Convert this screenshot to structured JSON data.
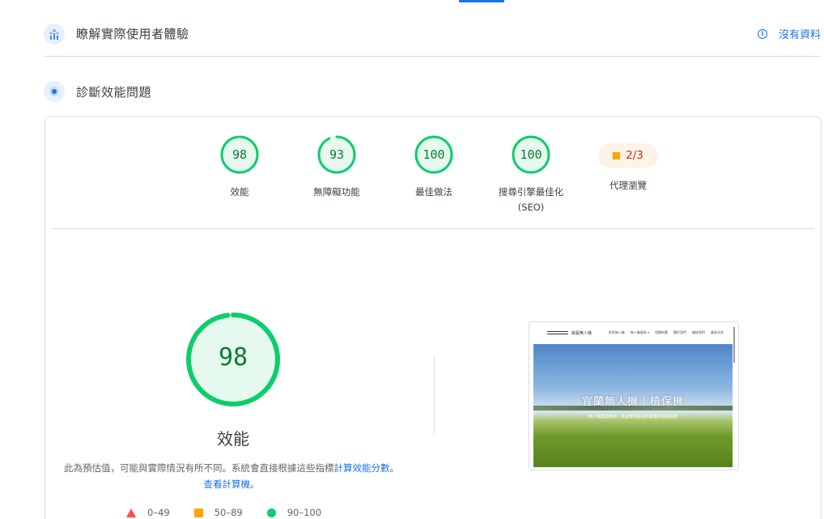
{
  "sections": {
    "experience_title": "瞭解實際使用者體驗",
    "no_data_label": "沒有資料",
    "diagnose_title": "診斷效能問題"
  },
  "gauges": [
    {
      "score": "98",
      "label": "效能",
      "value": 98
    },
    {
      "score": "93",
      "label": "無障礙功能",
      "value": 93
    },
    {
      "score": "100",
      "label": "最佳做法",
      "value": 100
    },
    {
      "score": "100",
      "label": "搜尋引擎最佳化",
      "label2": "(SEO)",
      "value": 100
    }
  ],
  "pwa": {
    "score": "2/3",
    "label": "代理瀏覽"
  },
  "main": {
    "score": "98",
    "value": 98,
    "title": "效能",
    "disclaimer_text": "此為預估值，可能與實際情況有所不同。系統會直接根據這些指標",
    "disclaimer_link1": "計算效能分數",
    "disclaimer_sep": "。",
    "disclaimer_link2": "查看計算機",
    "disclaimer_end": "。"
  },
  "legend": [
    {
      "range": "0–49",
      "shape": "triangle",
      "color": "#ff4e42"
    },
    {
      "range": "50–89",
      "shape": "square",
      "color": "#ffa400"
    },
    {
      "range": "90–100",
      "shape": "circle",
      "color": "#0cce6b"
    }
  ],
  "screenshot": {
    "site_name": "飯賓無人機",
    "menu": [
      "首頁無人機",
      "無人機服務 ▾",
      "相關新聞",
      "關於我們",
      "聯絡我們",
      "最新消息"
    ],
    "headline": "宜蘭無人機｜植保機",
    "subline": "無人機農業應用，為宜蘭地區提供專業的植保服務"
  },
  "colors": {
    "pass": "#0cce6b",
    "pass_bg": "#e6f9ef",
    "pass_text": "#0c7c30",
    "average": "#ffa400",
    "fail": "#ff4e42",
    "link": "#1a73e8"
  }
}
